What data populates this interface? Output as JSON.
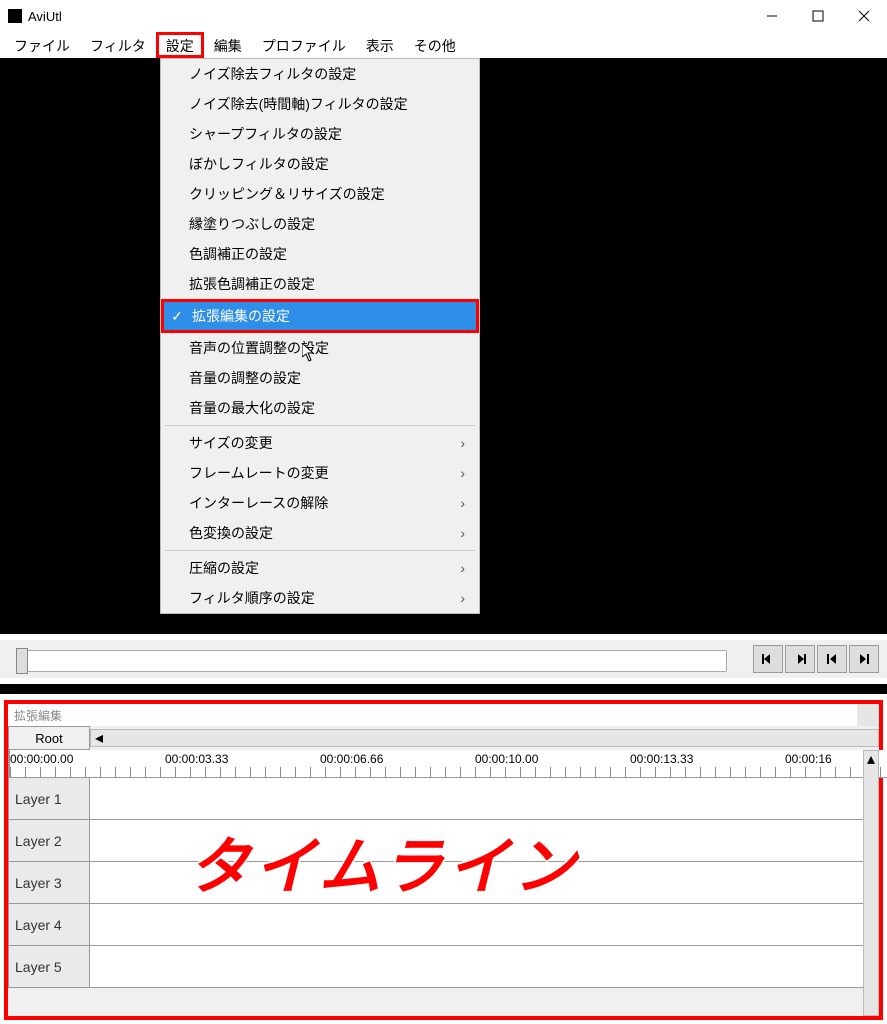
{
  "window": {
    "title": "AviUtl"
  },
  "menubar": {
    "items": [
      "ファイル",
      "フィルタ",
      "設定",
      "編集",
      "プロファイル",
      "表示",
      "その他"
    ],
    "highlighted_index": 2
  },
  "dropdown": {
    "groups": [
      [
        {
          "label": "ノイズ除去フィルタの設定"
        },
        {
          "label": "ノイズ除去(時間軸)フィルタの設定"
        },
        {
          "label": "シャープフィルタの設定"
        },
        {
          "label": "ぼかしフィルタの設定"
        },
        {
          "label": "クリッピング＆リサイズの設定"
        },
        {
          "label": "縁塗りつぶしの設定"
        },
        {
          "label": "色調補正の設定"
        },
        {
          "label": "拡張色調補正の設定"
        },
        {
          "label": "拡張編集の設定",
          "checked": true,
          "highlighted": true
        },
        {
          "label": "音声の位置調整の設定"
        },
        {
          "label": "音量の調整の設定"
        },
        {
          "label": "音量の最大化の設定"
        }
      ],
      [
        {
          "label": "サイズの変更",
          "submenu": true
        },
        {
          "label": "フレームレートの変更",
          "submenu": true
        },
        {
          "label": "インターレースの解除",
          "submenu": true
        },
        {
          "label": "色変換の設定",
          "submenu": true
        }
      ],
      [
        {
          "label": "圧縮の設定",
          "submenu": true
        },
        {
          "label": "フィルタ順序の設定",
          "submenu": true
        }
      ]
    ]
  },
  "timeline": {
    "title": "拡張編集",
    "root_label": "Root",
    "timestamps": [
      "00:00:00.00",
      "00:00:03.33",
      "00:00:06.66",
      "00:00:10.00",
      "00:00:13.33",
      "00:00:16"
    ],
    "layers": [
      "Layer 1",
      "Layer 2",
      "Layer 3",
      "Layer 4",
      "Layer 5"
    ],
    "annotation": "タイムライン"
  },
  "navbtns": [
    "step-back",
    "step-forward",
    "go-start",
    "go-end"
  ]
}
